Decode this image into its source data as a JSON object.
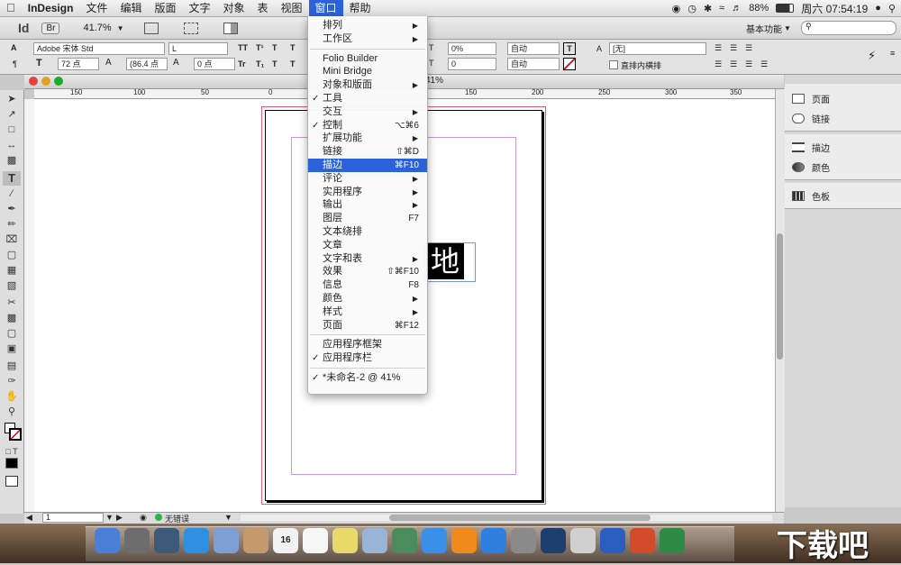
{
  "menubar": {
    "app": "InDesign",
    "items": [
      "文件",
      "编辑",
      "版面",
      "文字",
      "对象",
      "表",
      "视图",
      "窗口",
      "帮助"
    ],
    "active": "窗口",
    "battery": "88%",
    "clock": "周六 07:54:19"
  },
  "appbar": {
    "logo": "Id",
    "bridge": "Br",
    "zoom": "41.7%",
    "workspace": "基本功能",
    "search_placeholder": ""
  },
  "control": {
    "font_family": "Adobe 宋体 Std",
    "font_style": "L",
    "font_size": "72 点",
    "leading": "(86.4 点",
    "tracking": "0 点",
    "percent": "0%",
    "baseline": "0",
    "auto1": "自动",
    "auto2": "自动",
    "style_value": "[无]",
    "checkbox_label": "直排内横排"
  },
  "document": {
    "title_zoom": "41%",
    "glyph": "地",
    "status_page": "1",
    "status_errors": "无错误",
    "ruler_h": [
      "150",
      "100",
      "50",
      "0",
      "50",
      "100",
      "150",
      "200",
      "250",
      "300",
      "350"
    ],
    "ruler_v": [
      "0",
      "5",
      "0",
      "1",
      "0",
      "0",
      "1",
      "5",
      "0",
      "2",
      "0",
      "0",
      "2",
      "5",
      "0"
    ]
  },
  "panels": [
    {
      "icon": "pages-icon",
      "label": "页面"
    },
    {
      "icon": "links-icon",
      "label": "链接"
    },
    {
      "icon": "stroke-icon",
      "label": "描边"
    },
    {
      "icon": "color-icon",
      "label": "颜色"
    },
    {
      "icon": "swatches-icon",
      "label": "色板"
    }
  ],
  "menu": [
    {
      "label": "排列",
      "arrow": true
    },
    {
      "label": "工作区",
      "arrow": true
    },
    {
      "sep": true
    },
    {
      "label": "Folio Builder"
    },
    {
      "label": "Mini Bridge"
    },
    {
      "label": "对象和版面",
      "arrow": true
    },
    {
      "label": "工具",
      "check": true
    },
    {
      "label": "交互",
      "arrow": true
    },
    {
      "label": "控制",
      "check": true,
      "shortcut": "⌥⌘6"
    },
    {
      "label": "扩展功能",
      "arrow": true
    },
    {
      "label": "链接",
      "shortcut": "⇧⌘D"
    },
    {
      "label": "描边",
      "shortcut": "⌘F10",
      "highlight": true
    },
    {
      "label": "评论",
      "arrow": true
    },
    {
      "label": "实用程序",
      "arrow": true
    },
    {
      "label": "输出",
      "arrow": true
    },
    {
      "label": "图层",
      "shortcut": "F7"
    },
    {
      "label": "文本绕排"
    },
    {
      "label": "文章"
    },
    {
      "label": "文字和表",
      "arrow": true
    },
    {
      "label": "效果",
      "shortcut": "⇧⌘F10"
    },
    {
      "label": "信息",
      "shortcut": "F8"
    },
    {
      "label": "颜色",
      "arrow": true
    },
    {
      "label": "样式",
      "arrow": true
    },
    {
      "label": "页面",
      "shortcut": "⌘F12"
    },
    {
      "sep": true
    },
    {
      "label": "应用程序框架"
    },
    {
      "label": "应用程序栏",
      "check": true
    },
    {
      "sep": true
    },
    {
      "label": "*未命名-2 @ 41%",
      "check": true
    }
  ],
  "dock": [
    "Finder",
    "Launchpad",
    "Mission Control",
    "Safari",
    "Mail",
    "Contacts",
    "Calendar",
    "Reminders",
    "Notes",
    "Preview",
    "Photo",
    "iTunes",
    "iBooks",
    "App Store",
    "System Preferences",
    "Photoshop",
    "Help",
    "Word",
    "PowerPoint",
    "Excel"
  ],
  "dock_calendar_day": "16",
  "watermark": "下载吧"
}
